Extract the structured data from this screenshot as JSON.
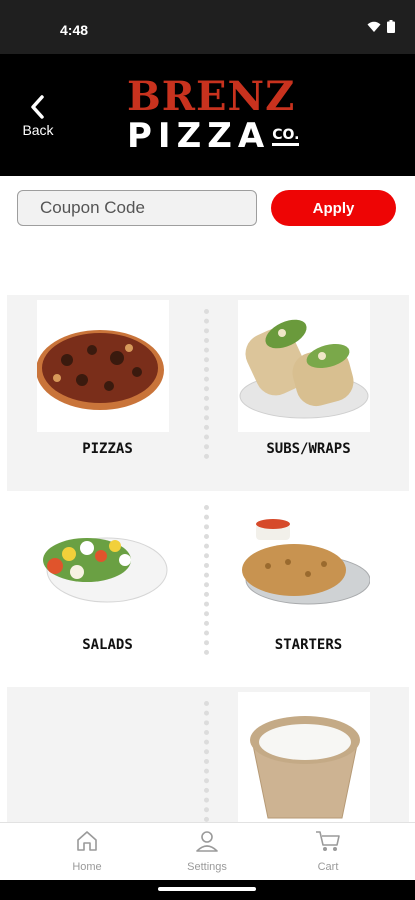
{
  "status_bar": {
    "time": "4:48",
    "wifi_icon": "wifi-icon",
    "battery_icon": "battery-icon"
  },
  "header": {
    "back_label": "Back",
    "back_icon": "chevron-left-icon",
    "logo": {
      "line1": "BRENZ",
      "line2": "PIZZA",
      "suffix": "CO."
    }
  },
  "coupon": {
    "placeholder": "Coupon Code",
    "apply_label": "Apply"
  },
  "categories": [
    {
      "label": "PIZZAS",
      "image": "pizza-image"
    },
    {
      "label": "SUBS/WRAPS",
      "image": "wrap-image"
    },
    {
      "label": "SALADS",
      "image": "salad-image"
    },
    {
      "label": "STARTERS",
      "image": "starter-image"
    },
    {
      "label": "",
      "image": ""
    },
    {
      "label": "",
      "image": "dressing-cup-image"
    }
  ],
  "bottom_nav": [
    {
      "label": "Home",
      "icon": "home-icon"
    },
    {
      "label": "Settings",
      "icon": "user-icon"
    },
    {
      "label": "Cart",
      "icon": "cart-icon"
    }
  ],
  "colors": {
    "accent": "#ee0505",
    "brand_red": "#c8321e",
    "header_bg": "#000000"
  }
}
